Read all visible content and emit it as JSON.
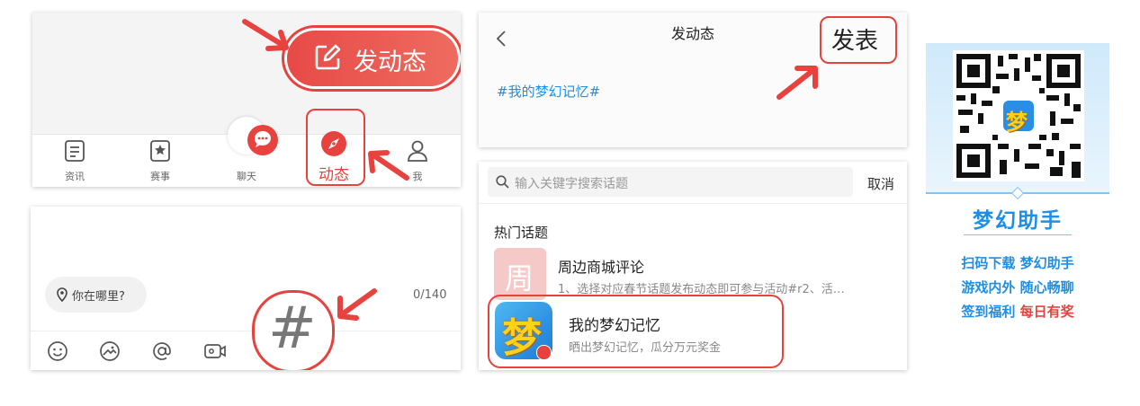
{
  "panel1": {
    "post_button_label": "发动态",
    "tabs": [
      {
        "label": "资讯",
        "icon": "news-icon"
      },
      {
        "label": "赛事",
        "icon": "trophy-icon"
      },
      {
        "label": "聊天",
        "icon": "chat-icon"
      },
      {
        "label": "动态",
        "icon": "compass-icon"
      },
      {
        "label": "我",
        "icon": "user-icon"
      }
    ]
  },
  "panel2": {
    "location_placeholder": "你在哪里?",
    "char_count": "0/140",
    "toolbar_icons": [
      "emoji-icon",
      "image-icon",
      "mention-icon",
      "video-icon"
    ],
    "hashtag_symbol": "#"
  },
  "panel3": {
    "title": "发动态",
    "publish_label": "发表",
    "topic_text": "#我的梦幻记忆#"
  },
  "panel4": {
    "search_placeholder": "输入关键字搜索话题",
    "cancel_label": "取消",
    "section_title": "热门话题",
    "topics": [
      {
        "badge": "周",
        "title": "周边商城评论",
        "desc": "1、选择对应春节话题发布动态即可参与活动#r2、活…"
      },
      {
        "badge": "梦",
        "title": "我的梦幻记忆",
        "desc": "晒出梦幻记忆，瓜分万元奖金"
      }
    ]
  },
  "qr": {
    "badge": "梦",
    "title": "梦幻助手",
    "lines": [
      {
        "a": "扫码下载",
        "b": "梦幻助手"
      },
      {
        "a": "游戏内外",
        "b": "随心畅聊"
      },
      {
        "a": "签到福利",
        "b": "每日有奖"
      }
    ],
    "colors": {
      "blue": "#1e8ee6",
      "red": "#e8423f"
    }
  }
}
